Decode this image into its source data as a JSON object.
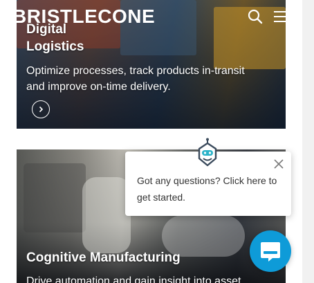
{
  "header": {
    "logo_text": "BRISTLECONE",
    "search_icon": "search-icon",
    "menu_icon": "hamburger-menu-icon"
  },
  "cards": [
    {
      "title_line1": "Digital",
      "title_line2": "Logistics",
      "description_line1": "Optimize processes, track products in-transit",
      "description_line2": "and improve on-time delivery.",
      "arrow_icon": "chevron-right-icon"
    },
    {
      "title": "Cognitive Manufacturing",
      "description": "Drive automation and gain insight into asset"
    }
  ],
  "chat": {
    "message": "Got any questions? Click here to get started.",
    "close_icon": "close-icon",
    "bot_icon": "chatbot-icon",
    "launcher_icon": "chat-bubble-icon",
    "accent_color": "#0e9bd8"
  }
}
